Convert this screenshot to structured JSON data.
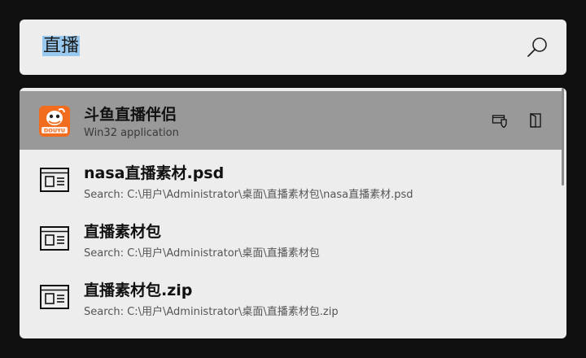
{
  "search": {
    "query": "直播"
  },
  "results": [
    {
      "title": "斗鱼直播伴侣",
      "subtitle": "Win32 application",
      "icon": "douyu-app-icon",
      "selected": true,
      "logo_text": "DOUYU"
    },
    {
      "title": "nasa直播素材.psd",
      "subtitle": "Search: C:\\用户\\Administrator\\桌面\\直播素材包\\nasa直播素材.psd",
      "icon": "window-document-icon"
    },
    {
      "title": "直播素材包",
      "subtitle": "Search: C:\\用户\\Administrator\\桌面\\直播素材包",
      "icon": "window-document-icon"
    },
    {
      "title": "直播素材包.zip",
      "subtitle": "Search: C:\\用户\\Administrator\\桌面\\直播素材包.zip",
      "icon": "window-document-icon"
    }
  ],
  "actions": [
    {
      "icon": "run-as-admin-icon"
    },
    {
      "icon": "open-folder-icon"
    }
  ],
  "colors": {
    "background": "#0f0f10",
    "panel": "#ededed",
    "selected_row": "#999999",
    "selection_highlight": "#99c9ee",
    "douyu_orange": "#f26c1e"
  }
}
